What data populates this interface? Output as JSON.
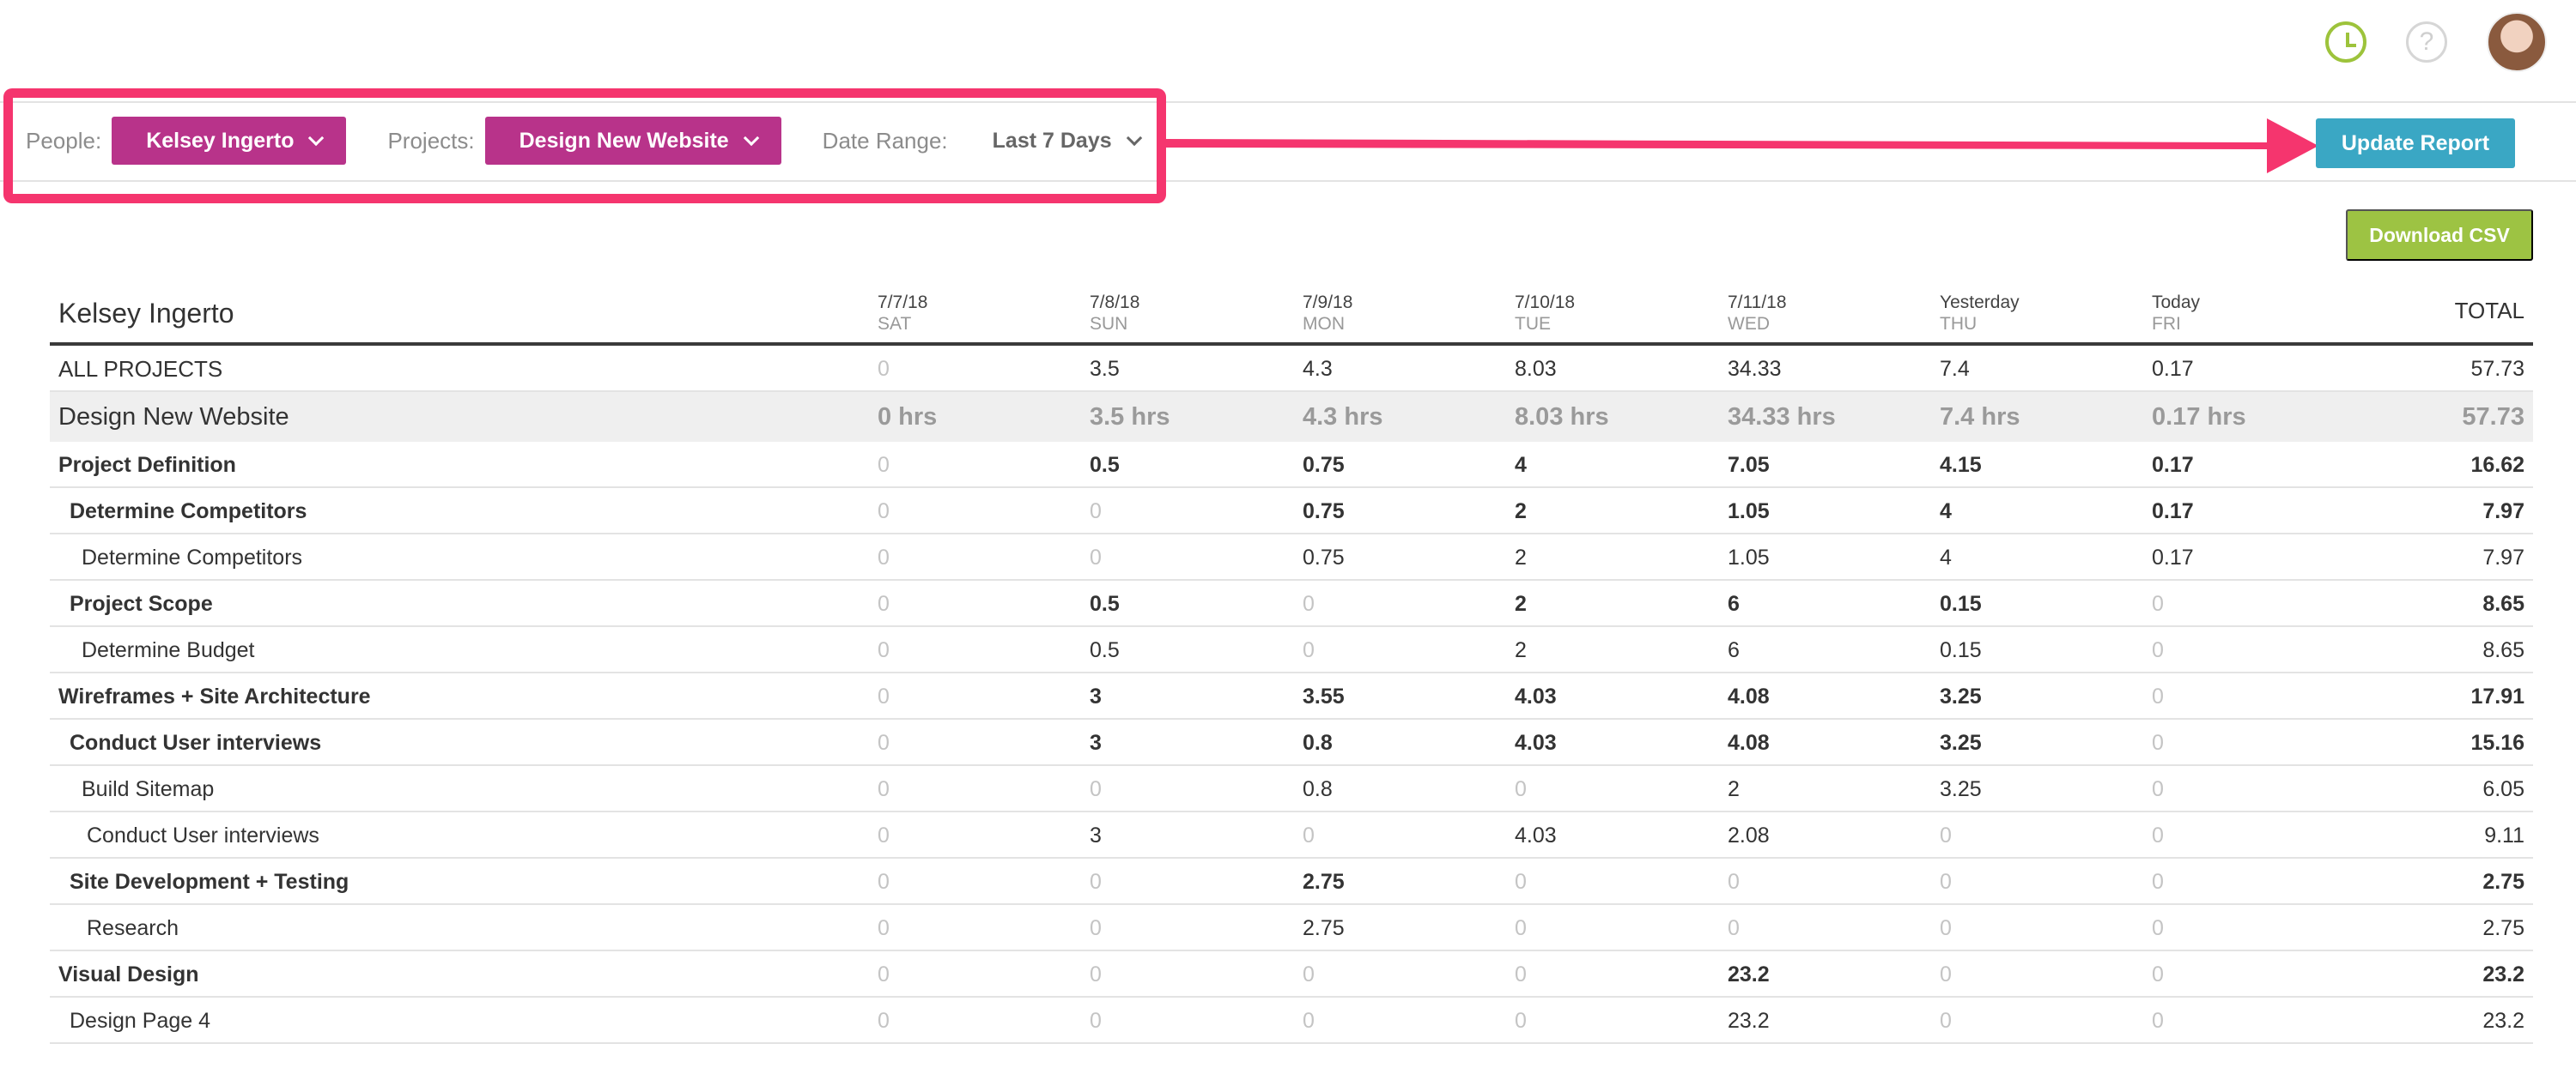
{
  "filters": {
    "people_label": "People:",
    "people_value": "Kelsey Ingerto",
    "projects_label": "Projects:",
    "projects_value": "Design New Website",
    "date_label": "Date Range:",
    "date_value": "Last 7 Days"
  },
  "buttons": {
    "update": "Update Report",
    "download": "Download CSV"
  },
  "icons": {
    "timer": "clock-icon",
    "help": "help-icon",
    "help_glyph": "?"
  },
  "colors": {
    "accent_magenta": "#b8338a",
    "update_blue": "#3aa7c4",
    "download_green": "#9dc343",
    "highlight_pink": "#f5356e",
    "timer_green": "#9dc33b"
  },
  "table": {
    "person": "Kelsey Ingerto",
    "total_label": "TOTAL",
    "columns": [
      {
        "date": "7/7/18",
        "dow": "SAT"
      },
      {
        "date": "7/8/18",
        "dow": "SUN"
      },
      {
        "date": "7/9/18",
        "dow": "MON"
      },
      {
        "date": "7/10/18",
        "dow": "TUE"
      },
      {
        "date": "7/11/18",
        "dow": "WED"
      },
      {
        "date": "Yesterday",
        "dow": "THU"
      },
      {
        "date": "Today",
        "dow": "FRI"
      }
    ],
    "rows": [
      {
        "name": "ALL PROJECTS",
        "style": "all",
        "indent": 0,
        "values": [
          "0",
          "3.5",
          "4.3",
          "8.03",
          "34.33",
          "7.4",
          "0.17"
        ],
        "total": "57.73"
      },
      {
        "name": "Design New Website",
        "style": "project",
        "indent": 0,
        "values": [
          "0 hrs",
          "3.5 hrs",
          "4.3 hrs",
          "8.03 hrs",
          "34.33 hrs",
          "7.4 hrs",
          "0.17 hrs"
        ],
        "total": "57.73"
      },
      {
        "name": "Project Definition",
        "style": "bold",
        "indent": 0,
        "values": [
          "0",
          "0.5",
          "0.75",
          "4",
          "7.05",
          "4.15",
          "0.17"
        ],
        "total": "16.62"
      },
      {
        "name": "Determine Competitors",
        "style": "bold",
        "indent": 1,
        "values": [
          "0",
          "0",
          "0.75",
          "2",
          "1.05",
          "4",
          "0.17"
        ],
        "total": "7.97"
      },
      {
        "name": "Determine Competitors",
        "style": "normal",
        "indent": 2,
        "values": [
          "0",
          "0",
          "0.75",
          "2",
          "1.05",
          "4",
          "0.17"
        ],
        "total": "7.97"
      },
      {
        "name": "Project Scope",
        "style": "bold",
        "indent": 1,
        "values": [
          "0",
          "0.5",
          "0",
          "2",
          "6",
          "0.15",
          "0"
        ],
        "total": "8.65"
      },
      {
        "name": "Determine Budget",
        "style": "normal",
        "indent": 2,
        "values": [
          "0",
          "0.5",
          "0",
          "2",
          "6",
          "0.15",
          "0"
        ],
        "total": "8.65"
      },
      {
        "name": "Wireframes + Site Architecture",
        "style": "bold",
        "indent": 0,
        "values": [
          "0",
          "3",
          "3.55",
          "4.03",
          "4.08",
          "3.25",
          "0"
        ],
        "total": "17.91"
      },
      {
        "name": "Conduct User interviews",
        "style": "bold",
        "indent": 1,
        "values": [
          "0",
          "3",
          "0.8",
          "4.03",
          "4.08",
          "3.25",
          "0"
        ],
        "total": "15.16"
      },
      {
        "name": "Build Sitemap",
        "style": "normal",
        "indent": 2,
        "values": [
          "0",
          "0",
          "0.8",
          "0",
          "2",
          "3.25",
          "0"
        ],
        "total": "6.05"
      },
      {
        "name": "Conduct User interviews",
        "style": "normal",
        "indent": 3,
        "values": [
          "0",
          "3",
          "0",
          "4.03",
          "2.08",
          "0",
          "0"
        ],
        "total": "9.11"
      },
      {
        "name": "Site Development + Testing",
        "style": "bold",
        "indent": 1,
        "values": [
          "0",
          "0",
          "2.75",
          "0",
          "0",
          "0",
          "0"
        ],
        "total": "2.75"
      },
      {
        "name": "Research",
        "style": "normal",
        "indent": 3,
        "values": [
          "0",
          "0",
          "2.75",
          "0",
          "0",
          "0",
          "0"
        ],
        "total": "2.75"
      },
      {
        "name": "Visual Design",
        "style": "bold",
        "indent": 0,
        "values": [
          "0",
          "0",
          "0",
          "0",
          "23.2",
          "0",
          "0"
        ],
        "total": "23.2"
      },
      {
        "name": "Design Page 4",
        "style": "normal",
        "indent": 1,
        "values": [
          "0",
          "0",
          "0",
          "0",
          "23.2",
          "0",
          "0"
        ],
        "total": "23.2"
      }
    ]
  }
}
